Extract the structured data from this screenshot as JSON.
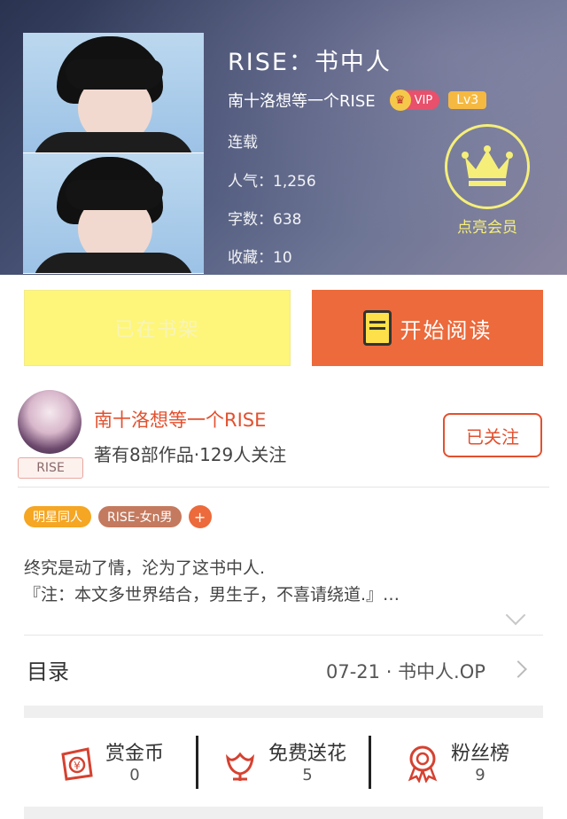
{
  "book": {
    "title": "RISE：书中人",
    "author": "南十洛想等一个RISE",
    "vip_label": "VIP",
    "level": "Lv3",
    "status": "连载",
    "popularity": "人气：1,256",
    "word_count": "字数：638",
    "favorites": "收藏：10"
  },
  "member": {
    "label": "点亮会员"
  },
  "actions": {
    "shelf_label": "已在书架",
    "read_label": "开始阅读"
  },
  "author_card": {
    "name": "南十洛想等一个RISE",
    "stats": "著有8部作品·129人关注",
    "avatar_tag": "RISE",
    "follow_label": "已关注"
  },
  "tags": [
    "明星同人",
    "RISE-女n男",
    "+"
  ],
  "description": {
    "line1": "终究是动了情，沦为了这书中人.",
    "line2": "『注：本文多世界结合，男生子，不喜请绕道.』…"
  },
  "toc": {
    "label": "目录",
    "latest": "07-21 · 书中人.OP"
  },
  "stats": [
    {
      "label": "赏金币",
      "value": "0"
    },
    {
      "label": "免费送花",
      "value": "5"
    },
    {
      "label": "粉丝榜",
      "value": "9"
    }
  ],
  "colors": {
    "accent": "#ec6a3b",
    "shelf": "#fdf67a",
    "member": "#f5ef7a"
  }
}
